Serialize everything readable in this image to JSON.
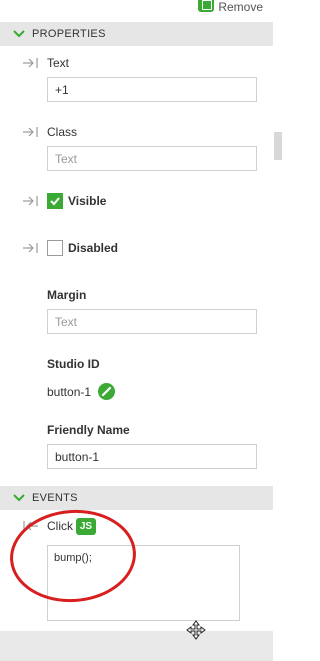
{
  "toolbar": {
    "remove_label": "Remove"
  },
  "properties": {
    "header": "PROPERTIES",
    "text": {
      "label": "Text",
      "value": "+1"
    },
    "class": {
      "label": "Class",
      "placeholder": "Text"
    },
    "visible": {
      "label": "Visible",
      "checked": true
    },
    "disabled": {
      "label": "Disabled",
      "checked": false
    },
    "margin": {
      "label": "Margin",
      "placeholder": "Text"
    },
    "studio_id": {
      "label": "Studio ID",
      "value": "button-1"
    },
    "friendly_name": {
      "label": "Friendly Name",
      "value": "button-1"
    }
  },
  "events": {
    "header": "EVENTS",
    "click": {
      "label": "Click",
      "badge": "JS",
      "code": "bump();"
    }
  },
  "colors": {
    "accent": "#3aaa35",
    "annotation": "#d81e1e",
    "section_bg": "#e6e6e6"
  }
}
